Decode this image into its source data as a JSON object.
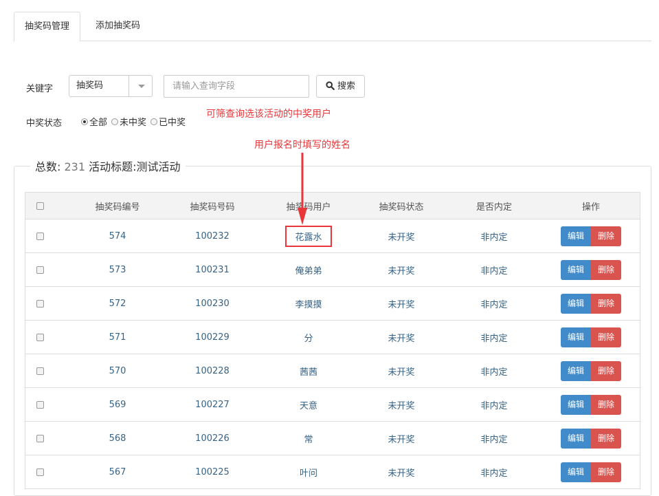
{
  "tabs": [
    {
      "label": "抽奖码管理"
    },
    {
      "label": "添加抽奖码"
    }
  ],
  "filter": {
    "keyword_label": "关键字",
    "select_value": "抽奖码",
    "search_placeholder": "请输入查询字段",
    "search_button": "搜索",
    "status_label": "中奖状态",
    "radio_options": [
      "全部",
      "未中奖",
      "已中奖"
    ],
    "radio_selected": "全部"
  },
  "annotations": {
    "filter_note": "可筛查询选该活动的中奖用户",
    "name_note": "用户报名时填写的姓名"
  },
  "summary": {
    "total_label": "总数:",
    "total_value": "231",
    "title_label": "活动标题:",
    "title_value": "测试活动"
  },
  "table": {
    "headers": [
      "抽奖码编号",
      "抽奖码号码",
      "抽奖码用户",
      "抽奖码状态",
      "是否内定",
      "操作"
    ],
    "edit_label": "编辑",
    "delete_label": "删除",
    "rows": [
      {
        "id": "574",
        "code": "100232",
        "user": "花露水",
        "status": "未开奖",
        "fixed": "非内定"
      },
      {
        "id": "573",
        "code": "100231",
        "user": "俺弟弟",
        "status": "未开奖",
        "fixed": "非内定"
      },
      {
        "id": "572",
        "code": "100230",
        "user": "李摸摸",
        "status": "未开奖",
        "fixed": "非内定"
      },
      {
        "id": "571",
        "code": "100229",
        "user": "分",
        "status": "未开奖",
        "fixed": "非内定"
      },
      {
        "id": "570",
        "code": "100228",
        "user": "茜茜",
        "status": "未开奖",
        "fixed": "非内定"
      },
      {
        "id": "569",
        "code": "100227",
        "user": "天意",
        "status": "未开奖",
        "fixed": "非内定"
      },
      {
        "id": "568",
        "code": "100226",
        "user": "常",
        "status": "未开奖",
        "fixed": "非内定"
      },
      {
        "id": "567",
        "code": "100225",
        "user": "叶问",
        "status": "未开奖",
        "fixed": "非内定"
      }
    ]
  },
  "colors": {
    "annotation": "#e8363a",
    "edit_button": "#428bca",
    "delete_button": "#d9534f",
    "cell_text": "#366285"
  }
}
